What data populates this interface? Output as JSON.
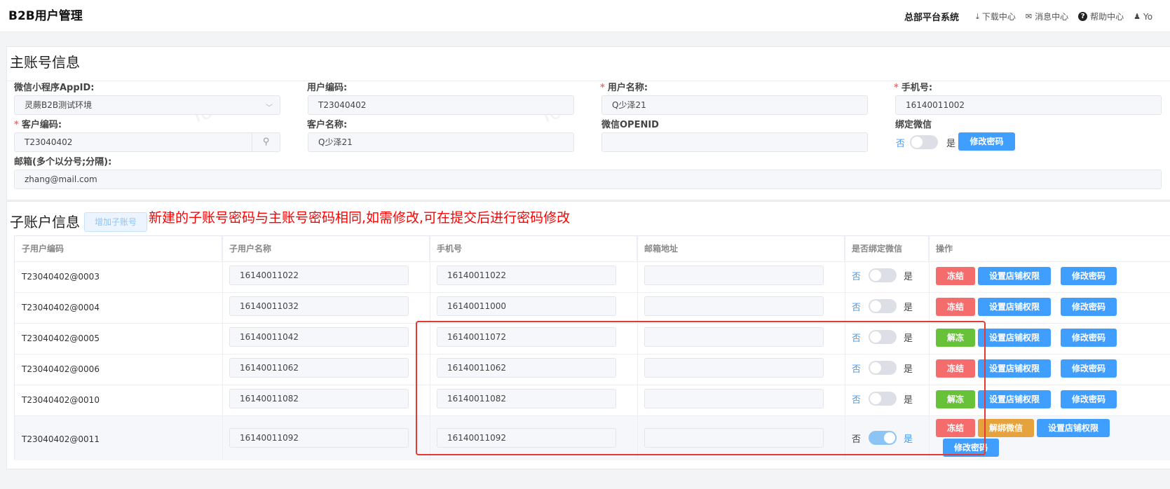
{
  "header": {
    "app_title": "B2B用户管理",
    "platform": "总部平台系统",
    "download_center": "下载中心",
    "message_center": "消息中心",
    "help_center": "帮助中心",
    "user": "Yo"
  },
  "watermark_text": "Yo",
  "main_account": {
    "title": "主账号信息",
    "appid_label": "微信小程序AppID:",
    "appid_value": "灵蕨B2B测试环境",
    "user_code_label": "用户编码:",
    "user_code_value": "T23040402",
    "user_name_label": "用户名称:",
    "user_name_value": "Q少泽21",
    "phone_label": "手机号:",
    "phone_value": "16140011002",
    "customer_code_label": "客户编码:",
    "customer_code_value": "T23040402",
    "customer_name_label": "客户名称:",
    "customer_name_value": "Q少泽21",
    "openid_label": "微信OPENID",
    "openid_value": "",
    "bind_wechat_label": "绑定微信",
    "switch_no": "否",
    "switch_yes": "是",
    "bind_wechat_on": false,
    "change_password": "修改密码",
    "email_label": "邮箱(多个以分号;分隔):",
    "email_value": "zhang@mail.com",
    "required_mark": "*"
  },
  "sub_account": {
    "title": "子账户信息",
    "add_button": "增加子账号",
    "notice": "新建的子账号密码与主账号密码相同,如需修改,可在提交后进行密码修改",
    "columns": [
      "子用户编码",
      "子用户名称",
      "手机号",
      "邮箱地址",
      "是否绑定微信",
      "操作"
    ],
    "rows": [
      {
        "code": "T23040402@0003",
        "name": "16140011022",
        "phone": "16140011022",
        "email": "",
        "bound": false,
        "freeze": "冻结",
        "unbind": "",
        "shop": "设置店铺权限",
        "pwd": "修改密码"
      },
      {
        "code": "T23040402@0004",
        "name": "16140011032",
        "phone": "16140011000",
        "email": "",
        "bound": false,
        "freeze": "冻结",
        "unbind": "",
        "shop": "设置店铺权限",
        "pwd": "修改密码"
      },
      {
        "code": "T23040402@0005",
        "name": "16140011042",
        "phone": "16140011072",
        "email": "",
        "bound": false,
        "freeze": "解冻",
        "unbind": "",
        "shop": "设置店铺权限",
        "pwd": "修改密码"
      },
      {
        "code": "T23040402@0006",
        "name": "16140011062",
        "phone": "16140011062",
        "email": "",
        "bound": false,
        "freeze": "冻结",
        "unbind": "",
        "shop": "设置店铺权限",
        "pwd": "修改密码"
      },
      {
        "code": "T23040402@0010",
        "name": "16140011082",
        "phone": "16140011082",
        "email": "",
        "bound": false,
        "freeze": "解冻",
        "unbind": "",
        "shop": "设置店铺权限",
        "pwd": "修改密码"
      },
      {
        "code": "T23040402@0011",
        "name": "16140011092",
        "phone": "16140011092",
        "email": "",
        "bound": true,
        "freeze": "冻结",
        "unbind": "解绑微信",
        "shop": "设置店铺权限",
        "pwd": "修改密码"
      }
    ],
    "switch_no": "否",
    "switch_yes": "是"
  },
  "colors": {
    "primary": "#409eff",
    "danger": "#f56c6c",
    "success": "#67c23a",
    "warning": "#e6a23c",
    "highlight_box": "#e53935"
  }
}
